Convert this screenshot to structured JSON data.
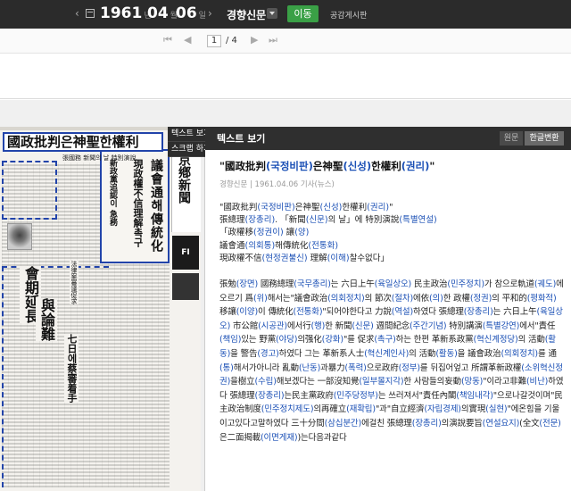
{
  "topbar": {
    "prev": "‹",
    "year": "1961",
    "year_unit": "년",
    "month": "04",
    "month_unit": "월",
    "day": "06",
    "day_unit": "일",
    "next": "›",
    "paper_name": "경향신문",
    "go_button": "이동",
    "board_link": "공감게시판"
  },
  "pager": {
    "current": "1",
    "total": "/ 4"
  },
  "sidetab": {
    "text_view": "텍스트 보기",
    "scrap": "스크랩 하기"
  },
  "newspaper_image": {
    "headline": "國政批判은神聖한權利",
    "sub": "張國務 新聞의 날 特別演說",
    "mast": "京鄕新聞",
    "big1": "議會通해傳統化",
    "big2": "現政權不信理解촉구",
    "big3": "新政黨追認이 急務",
    "left_big": "會期延長",
    "left_big2": "與論難",
    "mid_col": "法律案審議促求",
    "mid_big": "七日에蔡審着手",
    "ad_text": "FI"
  },
  "panel": {
    "title": "텍스트 보기",
    "original_button": "원문",
    "convert_button": "한글변환",
    "article_title": "\"國政批判(국정비판)은神聖(신성)한權利(권리)\"",
    "meta": "경향신문 | 1961.04.06 기사(뉴스)",
    "lines": [
      "\"國政批判(국정비판)은神聖(신성)한權利(권리)\"",
      "張總理(장총리). 「新聞(신문)의 날」에 特別演說(특별연설)",
      "「政權移(정권이) 讓(양)",
      "議會通(의회통)해傳統化(전통화)",
      "現政權不信(현정권불신) 理解(이해)찰수없다」"
    ],
    "body": "張勉(장면) 國務總理(국무총리)는 六日上午(육일상오) 民主政治(민주정치)가 참으로軌道(궤도)에 오르기 爲(위)해서는\"議會政治(의회정치)의 節次(절차)에依(의)한 政權(정권)의 平和的(평화적) 移讓(이양)이 傳統化(전통화)\"되어야한다고 力說(역설)하였다 張總理(장총리)는 六日上午(육일상오) 市公館(시공관)에서行(행)한 新聞(신문) 週間紀念(주간기념) 特別講演(특별강연)에서\"責任(책임)있는 野黨(야당)의强化(강화)\"를 促求(촉구)하는 한편 革新系政黨(혁신계정당)의 活動(활동)을 警告(경고)하였다 그는 革新系人士(혁신계인사)의 活動(활동)을 議會政治(의회정치)를 通(통)해서가아니라 亂動(난동)과暴力(폭력)으로政府(정부)를 뒤집어엎고 所謂革新政權(소위혁신정권)을樹立(수립)해보겠다는 一部沒知覺(일부몰지각)한 사람들의妄動(망동)\"이라고非難(비난)하였다 張總理(장총리)는民主黨政府(민주당정부)는 쓰러져서\"責任內閣(책임내각)\"으로나갈것이며\"民主政治制度(민주정치제도)의再確立(재확립)\"과\"自立經濟(자립경제)의實現(실현)\"에온힘을 기울이고있다고말하였다 三十分間(삼십분간)에걸친 張總理(장총리)의演說要旨(연설요지)(全文(전문)은二面揭載(이면게재))는다음과같다"
  }
}
